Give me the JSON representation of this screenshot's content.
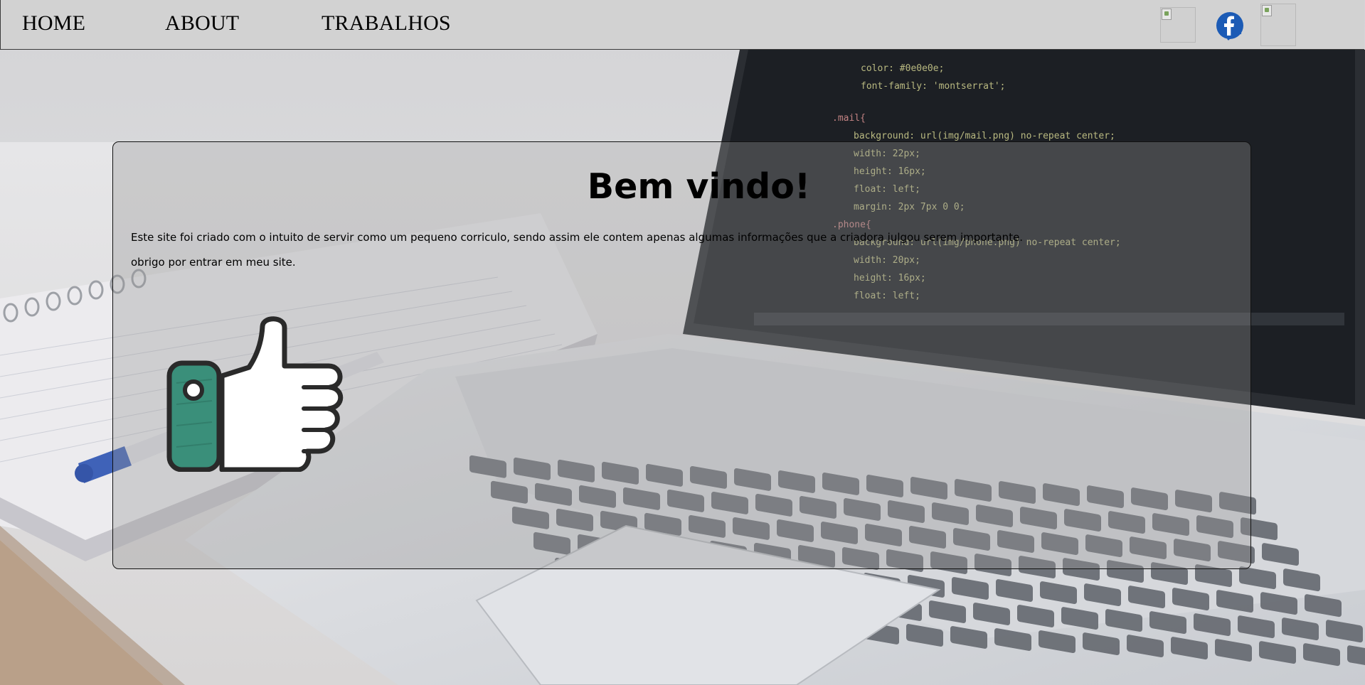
{
  "nav": {
    "home_label": "HOME",
    "about_label": "ABOUT",
    "trabalhos_label": "TRABALHOS"
  },
  "social": {
    "icons": [
      "broken-image-icon",
      "facebook-icon",
      "broken-image-icon"
    ]
  },
  "main": {
    "title": "Bem vindo!",
    "paragraph_1": "Este site foi criado com o intuito de servir como um pequeno corriculo, sendo assim ele contem apenas algumas informações que a criadora julgou serem importante.",
    "paragraph_2": "obrigo por entrar em meu site.",
    "image_icon": "thumbs-up-icon"
  },
  "colors": {
    "navbar_bg": "#d2d2d2",
    "card_overlay": "rgba(150,150,150,0.34)",
    "facebook_blue": "#1c5bb5",
    "thumb_cuff": "#3a8f7a"
  }
}
